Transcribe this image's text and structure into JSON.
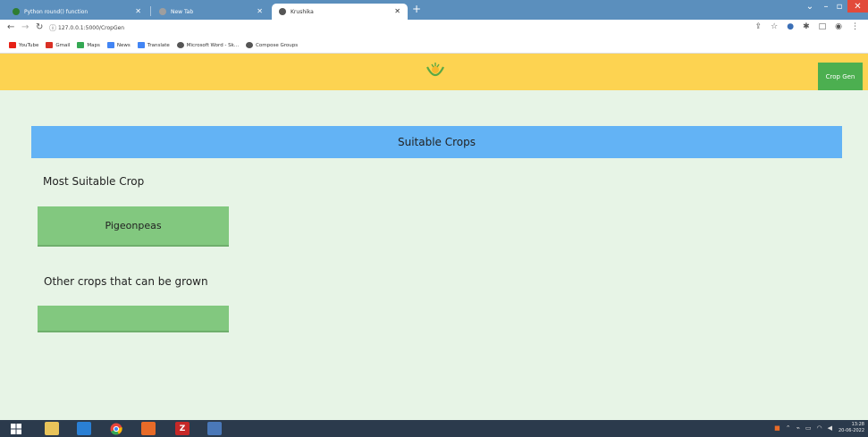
{
  "browser": {
    "tabs": [
      {
        "label": "Python round() function",
        "icon": "w3schools-icon",
        "color": "#2e7d32"
      },
      {
        "label": "New Tab",
        "icon": "newtab-icon",
        "color": "#9e9e9e"
      },
      {
        "label": "Krushika",
        "icon": "globe-icon",
        "color": "#555555",
        "active": true
      }
    ],
    "url": "127.0.0.1:5000/CropGen",
    "bookmarks": [
      "YouTube",
      "Gmail",
      "Maps",
      "News",
      "Translate",
      "Microsoft Word - Sk...",
      "Compose Groups"
    ]
  },
  "app": {
    "header_color": "#fdd351",
    "nav_button": "Crop Gen",
    "banner_title": "Suitable Crops",
    "most_suitable_label": "Most Suitable Crop",
    "most_suitable_crop": "Pigeonpeas",
    "other_crops_label": "Other crops that can be grown",
    "other_crops": []
  },
  "taskbar": {
    "clock_time": "13:28",
    "clock_date": "20-06-2022"
  }
}
